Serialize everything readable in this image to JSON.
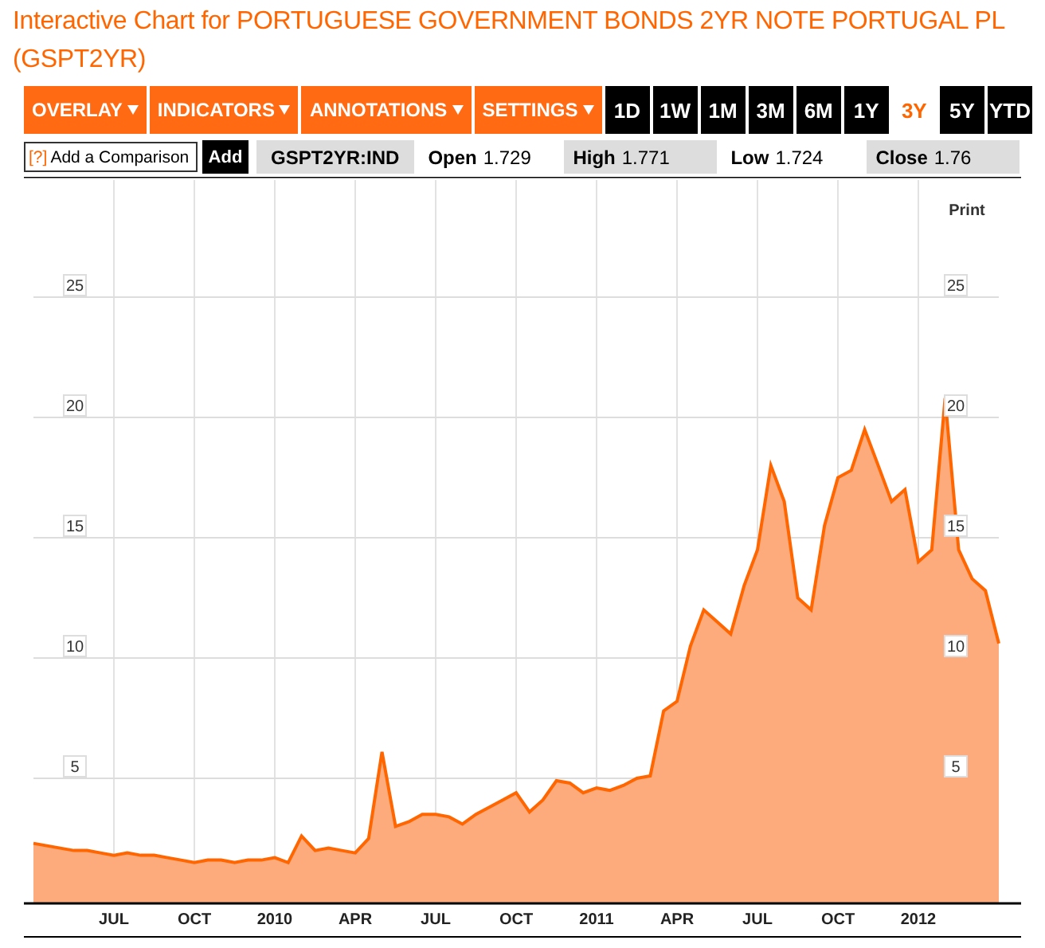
{
  "title": "Interactive Chart for PORTUGUESE GOVERNMENT BONDS 2YR NOTE PORTUGAL PL (GSPT2YR)",
  "menus": [
    {
      "label": "OVERLAY"
    },
    {
      "label": "INDICATORS"
    },
    {
      "label": "ANNOTATIONS"
    },
    {
      "label": "SETTINGS"
    }
  ],
  "periods": [
    {
      "label": "1D",
      "selected": false
    },
    {
      "label": "1W",
      "selected": false
    },
    {
      "label": "1M",
      "selected": false
    },
    {
      "label": "3M",
      "selected": false
    },
    {
      "label": "6M",
      "selected": false
    },
    {
      "label": "1Y",
      "selected": false
    },
    {
      "label": "3Y",
      "selected": true
    },
    {
      "label": "5Y",
      "selected": false
    },
    {
      "label": "YTD",
      "selected": false
    }
  ],
  "comparison": {
    "help": "[?]",
    "label": "Add a Comparison",
    "button": "Add"
  },
  "symbol": "GSPT2YR:IND",
  "stats": [
    {
      "label": "Open",
      "value": "1.729"
    },
    {
      "label": "High",
      "value": "1.771"
    },
    {
      "label": "Low",
      "value": "1.724"
    },
    {
      "label": "Close",
      "value": "1.76"
    }
  ],
  "print": "Print",
  "right_axis_labels": [
    "25",
    "20",
    "15",
    "10",
    "5"
  ],
  "chart_data": {
    "type": "area",
    "grid": true,
    "categories": [
      null,
      null,
      null,
      null,
      null,
      null,
      "JUL",
      null,
      null,
      null,
      null,
      null,
      "OCT",
      null,
      null,
      null,
      null,
      null,
      "2010",
      null,
      null,
      null,
      null,
      null,
      "APR",
      null,
      null,
      null,
      null,
      null,
      "JUL",
      null,
      null,
      null,
      null,
      null,
      "OCT",
      null,
      null,
      null,
      null,
      null,
      "2011",
      null,
      null,
      null,
      null,
      null,
      "APR",
      null,
      null,
      null,
      null,
      null,
      "JUL",
      null,
      null,
      null,
      null,
      null,
      "OCT",
      null,
      null,
      null,
      null,
      null,
      "2012",
      null,
      null,
      null,
      null,
      null,
      null
    ],
    "ylim": [
      0,
      25
    ],
    "yticks": [
      5,
      10,
      15,
      20,
      25
    ],
    "series": [
      {
        "color": "#ff6600",
        "values": [
          2.3,
          2.2,
          2.1,
          2.0,
          2.0,
          1.9,
          1.8,
          1.9,
          1.8,
          1.8,
          1.7,
          1.6,
          1.5,
          1.6,
          1.6,
          1.5,
          1.6,
          1.6,
          1.7,
          1.5,
          2.6,
          2.0,
          2.1,
          2.0,
          1.9,
          2.5,
          6.1,
          3.0,
          3.2,
          3.5,
          3.5,
          3.4,
          3.1,
          3.5,
          3.8,
          4.1,
          4.4,
          3.6,
          4.1,
          4.9,
          4.8,
          4.4,
          4.6,
          4.5,
          4.7,
          5.0,
          5.1,
          7.8,
          8.2,
          10.5,
          12.0,
          11.5,
          11.0,
          13.0,
          14.5,
          18.0,
          16.5,
          12.5,
          12.0,
          15.5,
          17.5,
          17.8,
          19.5,
          18.0,
          16.5,
          17.0,
          14.0,
          14.5,
          20.8,
          14.5,
          13.3,
          12.8,
          10.6
        ]
      }
    ]
  }
}
